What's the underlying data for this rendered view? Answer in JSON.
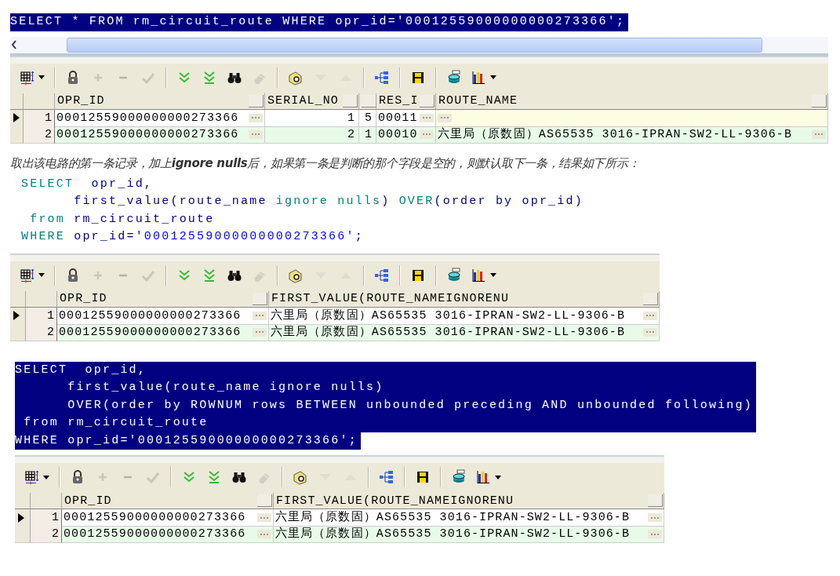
{
  "blocks": [
    {
      "kind": "code",
      "highlighted": true,
      "lines": [
        [
          {
            "kind": "plain",
            "text": "SELECT * FROM rm_circuit_route WHERE opr_id='00012559000000000273366';"
          }
        ]
      ]
    },
    {
      "kind": "grid",
      "scrollbar": true,
      "toolbar": [
        {
          "kind": "grid",
          "dropdown": true,
          "disabled": false
        },
        {
          "kind": "separator"
        },
        {
          "kind": "lock",
          "disabled": false
        },
        {
          "kind": "plus",
          "disabled": true
        },
        {
          "kind": "minus",
          "disabled": true
        },
        {
          "kind": "check",
          "disabled": true
        },
        {
          "kind": "separator"
        },
        {
          "kind": "fetch-next",
          "disabled": false
        },
        {
          "kind": "fetch-last",
          "disabled": false
        },
        {
          "kind": "find",
          "disabled": false
        },
        {
          "kind": "clear",
          "disabled": true
        },
        {
          "kind": "separator"
        },
        {
          "kind": "qbe",
          "disabled": false
        },
        {
          "kind": "filter-down",
          "disabled": true
        },
        {
          "kind": "filter-up",
          "disabled": true
        },
        {
          "kind": "separator"
        },
        {
          "kind": "tree",
          "disabled": false
        },
        {
          "kind": "separator"
        },
        {
          "kind": "save",
          "disabled": false
        },
        {
          "kind": "separator"
        },
        {
          "kind": "export",
          "disabled": false
        },
        {
          "kind": "chart",
          "dropdown": true,
          "disabled": false
        }
      ],
      "columns": [
        {
          "label": "OPR_ID",
          "kind": "text"
        },
        {
          "label": "SERIAL_NO",
          "kind": "number"
        },
        {
          "kind": "number"
        },
        {
          "label": "RES_I",
          "kind": "text"
        },
        {
          "label": "ROUTE_NAME",
          "kind": "text"
        }
      ],
      "rows": [
        {
          "number": "1",
          "current": true,
          "cells": [
            {
              "text": "00012559000000000273366",
              "focused": false
            },
            {
              "text": "1",
              "focused": false
            },
            {
              "text": "5",
              "focused": false
            },
            {
              "text": "00011",
              "focused": false
            },
            {
              "focused": true
            }
          ]
        },
        {
          "number": "2",
          "current": false,
          "cells": [
            {
              "text": "00012559000000000273366",
              "focused": false
            },
            {
              "text": "2",
              "focused": false
            },
            {
              "text": "1",
              "focused": false
            },
            {
              "text": "00010",
              "focused": false
            },
            {
              "text": "六里局（原数固）AS65535 3016-IPRAN-SW2-LL-9306-B",
              "focused": false
            }
          ]
        }
      ]
    },
    {
      "kind": "paragraph",
      "text": "取出该电路的第一条记录，加上**ignore nulls**后，如果第一条是判断的那个字段是空的，则默认取下一条，结果如下所示："
    },
    {
      "kind": "code",
      "highlighted": false,
      "lines": [
        [
          {
            "kind": "keyword",
            "text": "SELECT"
          },
          {
            "kind": "plain",
            "text": "  opr_id,"
          }
        ],
        [
          {
            "kind": "plain",
            "text": "      first_value(route_name "
          },
          {
            "kind": "keyword",
            "text": "ignore nulls"
          },
          {
            "kind": "plain",
            "text": ") "
          },
          {
            "kind": "keyword",
            "text": "OVER"
          },
          {
            "kind": "plain",
            "text": "(order by opr_id)"
          }
        ],
        [
          {
            "kind": "keyword",
            "text": " from"
          },
          {
            "kind": "plain",
            "text": " rm_circuit_route"
          }
        ],
        [
          {
            "kind": "keyword",
            "text": "WHERE"
          },
          {
            "kind": "plain",
            "text": " opr_id="
          },
          {
            "kind": "string",
            "text": "'00012559000000000273366'"
          },
          {
            "kind": "plain",
            "text": ";"
          }
        ]
      ]
    },
    {
      "kind": "grid",
      "toolbar": [
        {
          "kind": "grid",
          "dropdown": true,
          "disabled": false
        },
        {
          "kind": "separator"
        },
        {
          "kind": "lock",
          "disabled": false
        },
        {
          "kind": "plus",
          "disabled": true
        },
        {
          "kind": "minus",
          "disabled": true
        },
        {
          "kind": "check",
          "disabled": true
        },
        {
          "kind": "separator"
        },
        {
          "kind": "fetch-next",
          "disabled": false
        },
        {
          "kind": "fetch-last",
          "disabled": false
        },
        {
          "kind": "find",
          "disabled": false
        },
        {
          "kind": "clear",
          "disabled": true
        },
        {
          "kind": "separator"
        },
        {
          "kind": "qbe",
          "disabled": false
        },
        {
          "kind": "filter-down",
          "disabled": true
        },
        {
          "kind": "filter-up",
          "disabled": true
        },
        {
          "kind": "separator"
        },
        {
          "kind": "tree",
          "disabled": false
        },
        {
          "kind": "separator"
        },
        {
          "kind": "save",
          "disabled": false
        },
        {
          "kind": "separator"
        },
        {
          "kind": "export",
          "disabled": false
        },
        {
          "kind": "chart",
          "dropdown": true,
          "disabled": false
        }
      ],
      "columns": [
        {
          "label": "OPR_ID",
          "kind": "text"
        },
        {
          "label": "FIRST_VALUE(ROUTE_NAMEIGNORENU",
          "kind": "text"
        }
      ],
      "rows": [
        {
          "number": "1",
          "current": true,
          "cells": [
            {
              "text": "00012559000000000273366",
              "focused": false
            },
            {
              "text": "六里局（原数固）AS65535 3016-IPRAN-SW2-LL-9306-B",
              "focused": false
            }
          ]
        },
        {
          "number": "2",
          "current": false,
          "cells": [
            {
              "text": "00012559000000000273366",
              "focused": false
            },
            {
              "text": "六里局（原数固）AS65535 3016-IPRAN-SW2-LL-9306-B",
              "focused": false
            }
          ]
        }
      ]
    },
    {
      "kind": "code",
      "highlighted": true,
      "lines": [
        [
          {
            "kind": "plain",
            "text": "SELECT  opr_id,"
          }
        ],
        [
          {
            "kind": "plain",
            "text": "      first_value(route_name ignore nulls)"
          }
        ],
        [
          {
            "kind": "plain",
            "text": "      OVER(order by ROWNUM rows BETWEEN unbounded preceding AND unbounded following)"
          }
        ],
        [
          {
            "kind": "plain",
            "text": " from rm_circuit_route"
          }
        ],
        [
          {
            "kind": "plain",
            "text": "WHERE opr_id='00012559000000000273366';"
          }
        ]
      ]
    },
    {
      "kind": "grid",
      "toolbar": [
        {
          "kind": "grid",
          "dropdown": true,
          "disabled": false
        },
        {
          "kind": "separator"
        },
        {
          "kind": "lock",
          "disabled": false
        },
        {
          "kind": "plus",
          "disabled": true
        },
        {
          "kind": "minus",
          "disabled": true
        },
        {
          "kind": "check",
          "disabled": true
        },
        {
          "kind": "separator"
        },
        {
          "kind": "fetch-next",
          "disabled": false
        },
        {
          "kind": "fetch-last",
          "disabled": false
        },
        {
          "kind": "find",
          "disabled": false
        },
        {
          "kind": "clear",
          "disabled": true
        },
        {
          "kind": "separator"
        },
        {
          "kind": "qbe",
          "disabled": false
        },
        {
          "kind": "filter-down",
          "disabled": true
        },
        {
          "kind": "filter-up",
          "disabled": true
        },
        {
          "kind": "separator"
        },
        {
          "kind": "tree",
          "disabled": false
        },
        {
          "kind": "separator"
        },
        {
          "kind": "save",
          "disabled": false
        },
        {
          "kind": "separator"
        },
        {
          "kind": "export",
          "disabled": false
        },
        {
          "kind": "chart",
          "dropdown": true,
          "disabled": false
        }
      ],
      "columns": [
        {
          "label": "OPR_ID",
          "kind": "text"
        },
        {
          "label": "FIRST_VALUE(ROUTE_NAMEIGNORENU",
          "kind": "text"
        }
      ],
      "rows": [
        {
          "number": "1",
          "current": true,
          "cells": [
            {
              "text": "00012559000000000273366",
              "focused": false
            },
            {
              "text": "六里局（原数固）AS65535 3016-IPRAN-SW2-LL-9306-B",
              "focused": false
            }
          ]
        },
        {
          "number": "2",
          "current": false,
          "cells": [
            {
              "text": "00012559000000000273366",
              "focused": false
            },
            {
              "text": "六里局（原数固）AS65535 3016-IPRAN-SW2-LL-9306-B",
              "focused": false
            }
          ]
        }
      ]
    }
  ]
}
